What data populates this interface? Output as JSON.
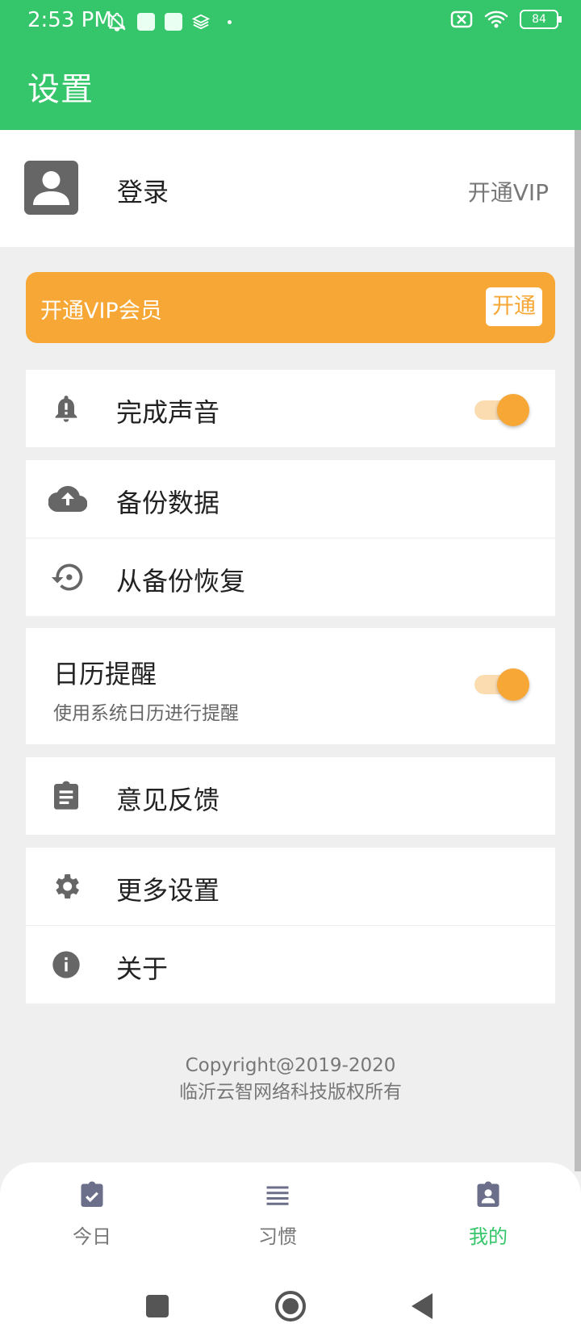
{
  "status_bar": {
    "time": "2:53 PM",
    "battery": "84"
  },
  "header": {
    "title": "设置"
  },
  "account": {
    "login_label": "登录",
    "vip_link": "开通VIP"
  },
  "vip_banner": {
    "text": "开通VIP会员",
    "button": "开通"
  },
  "settings": {
    "complete_sound": {
      "label": "完成声音",
      "enabled": true
    },
    "backup": "备份数据",
    "restore": "从备份恢复",
    "calendar": {
      "title": "日历提醒",
      "subtitle": "使用系统日历进行提醒",
      "enabled": true
    },
    "feedback": "意见反馈",
    "more_settings": "更多设置",
    "about": "关于"
  },
  "footer": {
    "line1": "Copyright@2019-2020",
    "line2": "临沂云智网络科技版权所有"
  },
  "bottom_nav": {
    "items": [
      {
        "label": "今日",
        "icon": "clipboard-check-icon",
        "active": false
      },
      {
        "label": "习惯",
        "icon": "list-icon",
        "active": false
      },
      {
        "label": "我的",
        "icon": "clipboard-account-icon",
        "active": true
      }
    ]
  },
  "colors": {
    "primary": "#35c56a",
    "accent": "#f6a735",
    "icon_gray": "#666666"
  }
}
